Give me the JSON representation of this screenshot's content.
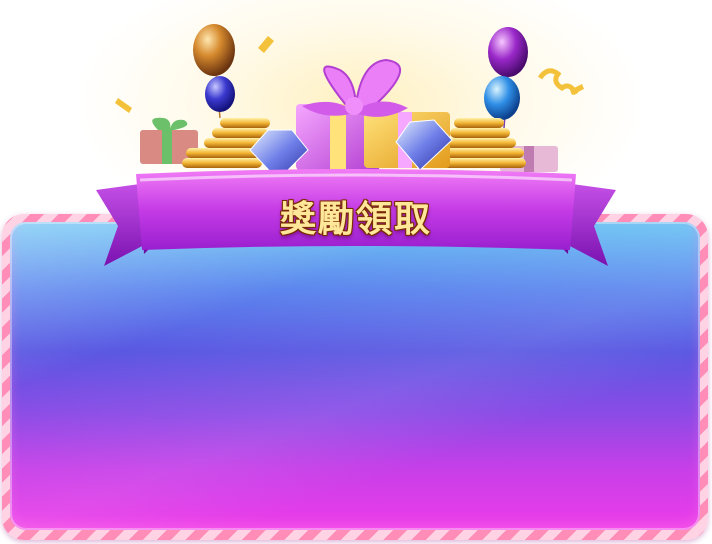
{
  "dialog": {
    "title": "獎勵領取"
  },
  "decorations": {
    "items": [
      "balloon-icon",
      "gift-box-icon",
      "gold-coin-stack-icon",
      "diamond-icon",
      "confetti-icon"
    ]
  },
  "colors": {
    "ribbon": "#c53ce6",
    "panel_top": "#6fc6f4",
    "panel_bottom": "#ee3cea",
    "title_text": "#ffe79a",
    "frame": "#ff8db8"
  }
}
